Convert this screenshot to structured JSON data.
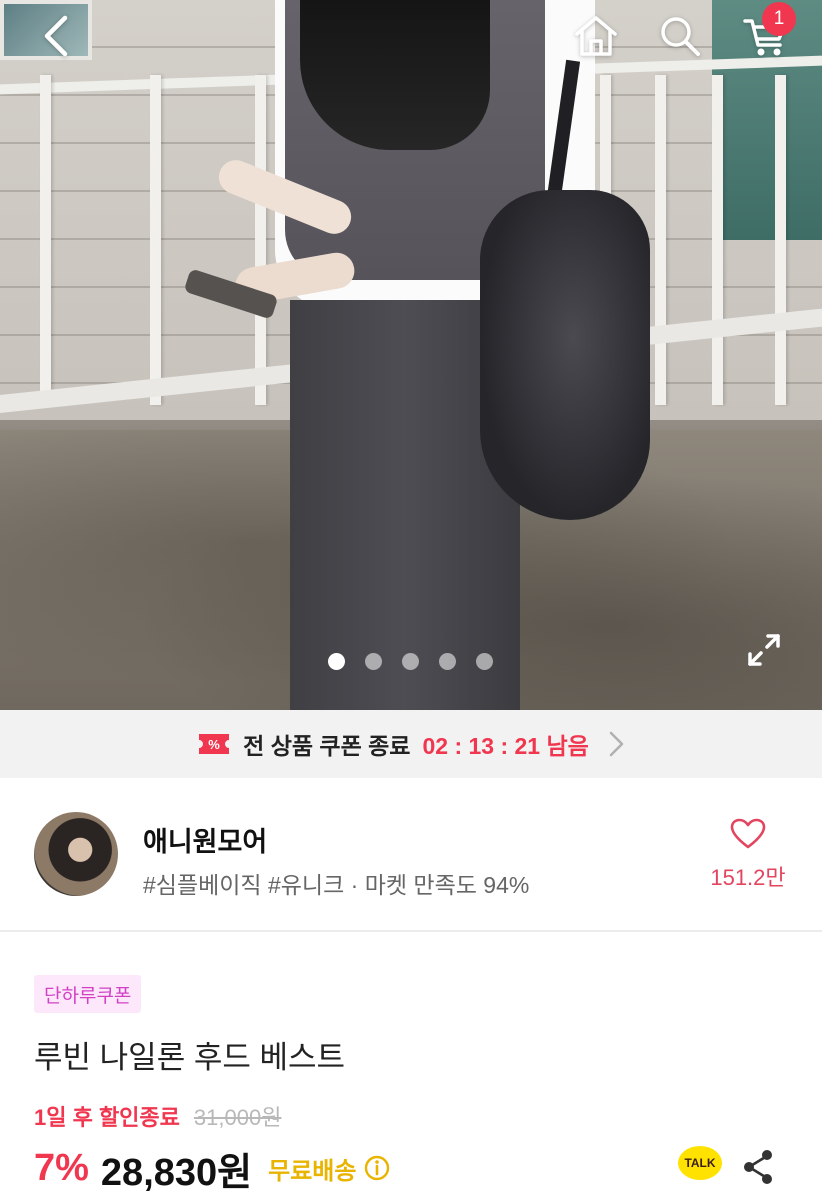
{
  "header": {
    "back_icon": "chevron-left-icon",
    "home_icon": "home-icon",
    "search_icon": "search-icon",
    "cart_icon": "cart-icon",
    "cart_count": "1"
  },
  "gallery": {
    "slide_count": 5,
    "active_slide": 1,
    "expand_icon": "expand-icon"
  },
  "coupon_banner": {
    "icon": "coupon-icon",
    "text": "전 상품 쿠폰 종료",
    "timer": "02 : 13 : 21 남음"
  },
  "shop": {
    "name": "애니원모어",
    "tags": "#심플베이직 #유니크 · 마켓 만족도 94%",
    "like_count": "151.2만",
    "like_icon": "heart-outline-icon"
  },
  "product": {
    "badge": "단하루쿠폰",
    "title": "루빈 나일론 후드 베스트",
    "discount_end": "1일 후 할인종료",
    "original_price": "31,000원",
    "discount_percent": "7%",
    "sale_price": "28,830원",
    "shipping": "무료배송",
    "talk_label": "TALK"
  },
  "colors": {
    "accent": "#f0374f",
    "badge_bg": "#fde8fb",
    "badge_text": "#d241c4",
    "shipping": "#e8b400"
  }
}
